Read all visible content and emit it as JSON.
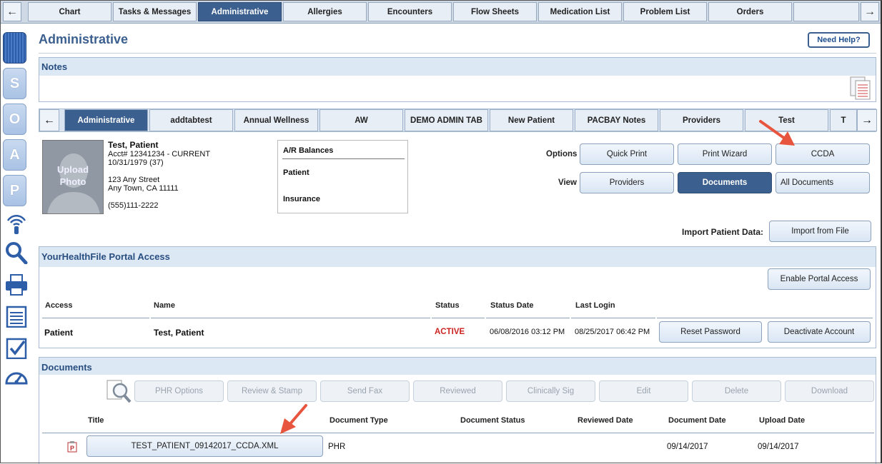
{
  "top_tabs": [
    "Chart",
    "Tasks & Messages",
    "Administrative",
    "Allergies",
    "Encounters",
    "Flow Sheets",
    "Medication List",
    "Problem List",
    "Orders"
  ],
  "nav": {
    "left_arrow": "←",
    "right_arrow": "→"
  },
  "soap_letters": [
    "S",
    "O",
    "A",
    "P"
  ],
  "page_title": "Administrative",
  "help_label": "Need Help?",
  "notes": {
    "title": "Notes"
  },
  "sub_tabs": [
    "Administrative",
    "addtabtest",
    "Annual Wellness",
    "AW",
    "DEMO ADMIN TAB",
    "New Patient",
    "PACBAY Notes",
    "Providers",
    "Test",
    "T"
  ],
  "patient": {
    "photo_label_1": "Upload",
    "photo_label_2": "Photo",
    "name": "Test, Patient",
    "acct": "Acct# 12341234 - CURRENT",
    "dob": "10/31/1979 (37)",
    "address1": "123 Any Street",
    "address2": "Any Town, CA 11111",
    "phone": "(555)111-2222"
  },
  "ar": {
    "title": "A/R Balances",
    "patient": "Patient",
    "insurance": "Insurance"
  },
  "options": {
    "label": "Options",
    "quick_print": "Quick Print",
    "print_wizard": "Print Wizard",
    "ccda": "CCDA"
  },
  "view": {
    "label": "View",
    "providers": "Providers",
    "documents": "Documents",
    "all_documents": "All Documents"
  },
  "import": {
    "label": "Import Patient Data:",
    "button": "Import from File"
  },
  "portal": {
    "title": "YourHealthFile Portal Access",
    "enable": "Enable Portal Access",
    "headers": [
      "Access",
      "Name",
      "Status",
      "Status Date",
      "Last Login"
    ],
    "row": {
      "access": "Patient",
      "name": "Test, Patient",
      "status": "ACTIVE",
      "status_date": "06/08/2016 03:12 PM",
      "last_login": "08/25/2017 06:42 PM"
    },
    "reset": "Reset Password",
    "deactivate": "Deactivate Account"
  },
  "documents": {
    "title": "Documents",
    "actions": [
      "PHR Options",
      "Review & Stamp",
      "Send Fax",
      "Reviewed",
      "Clinically Sig",
      "Edit",
      "Delete",
      "Download"
    ],
    "headers": [
      "Title",
      "Document Type",
      "Document Status",
      "Reviewed Date",
      "Document Date",
      "Upload Date"
    ],
    "row": {
      "title": "TEST_PATIENT_09142017_CCDA.XML",
      "type": "PHR",
      "status": "",
      "reviewed": "",
      "doc_date": "09/14/2017",
      "upload_date": "09/14/2017"
    }
  },
  "colors": {
    "brand": "#3b5f8e",
    "active_status": "#cc2222",
    "annotation_arrow": "#e8553e"
  }
}
